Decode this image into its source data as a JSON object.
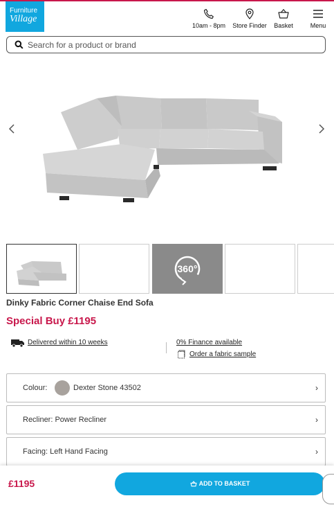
{
  "brand": {
    "line1": "Furniture",
    "line2": "Village"
  },
  "header": {
    "phone_label": "10am - 8pm",
    "store_label": "Store Finder",
    "basket_label": "Basket",
    "menu_label": "Menu"
  },
  "search": {
    "placeholder": "Search for a product or brand"
  },
  "thumbs": {
    "badge_360": "360°"
  },
  "product": {
    "title": "Dinky Fabric Corner Chaise End Sofa",
    "price": "Special Buy £1195"
  },
  "info": {
    "delivery": "Delivered within 10 weeks",
    "finance": "0% Finance available",
    "sample": "Order a fabric sample"
  },
  "options": {
    "colour_label": "Colour:",
    "colour_value": "Dexter Stone 43502",
    "colour_swatch": "#a8a29d",
    "recliner": "Recliner: Power Recliner",
    "facing": "Facing: Left Hand Facing"
  },
  "footer": {
    "price": "£1195",
    "add_label": "ADD TO BASKET"
  },
  "colors": {
    "accent": "#c8174b",
    "brand_blue": "#11a7df"
  }
}
